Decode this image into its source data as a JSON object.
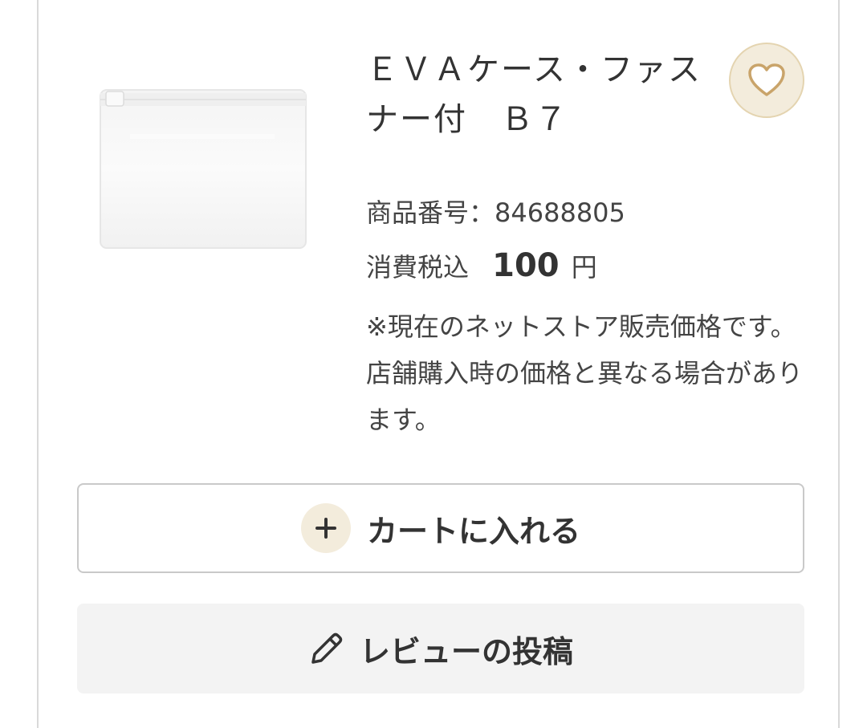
{
  "product": {
    "title": "ＥＶＡケース・ファスナー付　Ｂ７",
    "sku_label": "商品番号：",
    "sku": "84688805",
    "price_label": "消費税込",
    "price": "100",
    "price_unit": "円",
    "note": "※現在のネットストア販売価格です。店舗購入時の価格と異なる場合があります。",
    "image_icon": "eva-case-pouch-image"
  },
  "actions": {
    "favorite_icon": "heart-icon",
    "cart_label": "カートに入れる",
    "cart_icon": "plus-icon",
    "review_label": "レビューの投稿",
    "review_icon": "pencil-icon"
  },
  "colors": {
    "accent_beige": "#f3ecdc",
    "accent_border": "#e4d4b0",
    "text": "#333333",
    "button_gray": "#f3f3f3"
  }
}
